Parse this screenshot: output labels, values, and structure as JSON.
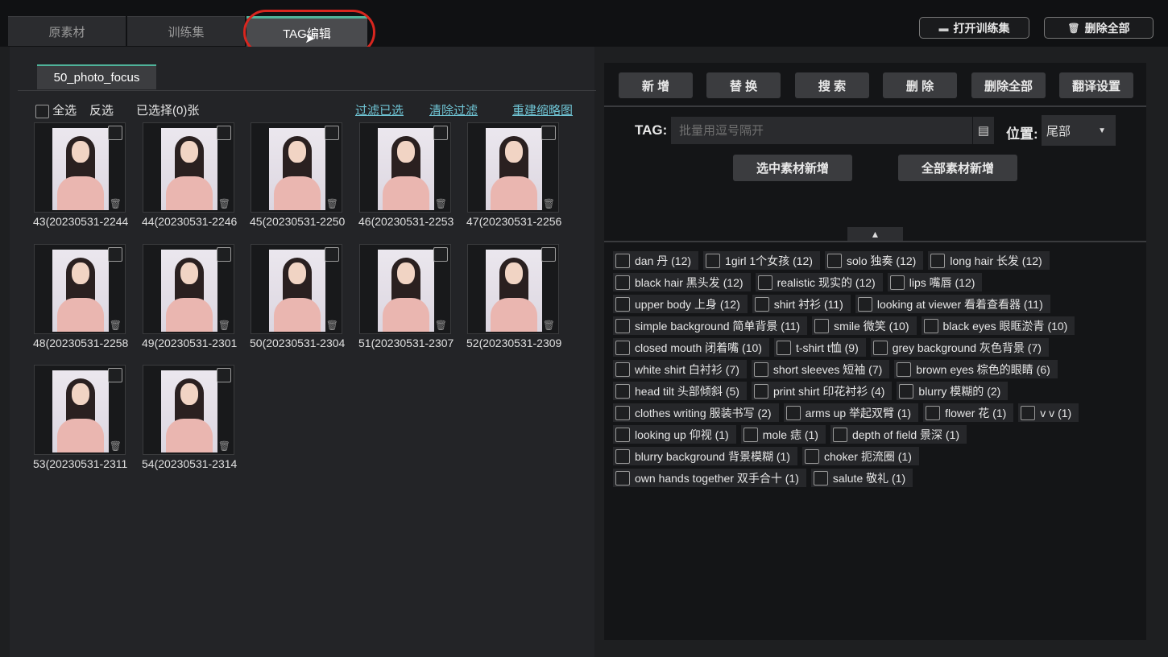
{
  "tabs": [
    {
      "label": "原素材"
    },
    {
      "label": "训练集"
    },
    {
      "label": "TAG编辑"
    }
  ],
  "top_buttons": {
    "open_training": "打开训练集",
    "delete_all": "删除全部"
  },
  "left": {
    "subtab": "50_photo_focus",
    "select_all": "全选",
    "invert": "反选",
    "selected_count": "已选择(0)张",
    "links": [
      "过滤已选",
      "清除过滤",
      "重建缩略图"
    ],
    "images": [
      {
        "name": "43(20230531-2244"
      },
      {
        "name": "44(20230531-2246"
      },
      {
        "name": "45(20230531-2250"
      },
      {
        "name": "46(20230531-2253"
      },
      {
        "name": "47(20230531-2256"
      },
      {
        "name": "48(20230531-2258"
      },
      {
        "name": "49(20230531-2301"
      },
      {
        "name": "50(20230531-2304"
      },
      {
        "name": "51(20230531-2307"
      },
      {
        "name": "52(20230531-2309"
      },
      {
        "name": "53(20230531-2311"
      },
      {
        "name": "54(20230531-2314"
      }
    ]
  },
  "right": {
    "toolbar": [
      "新 增",
      "替 换",
      "搜 索",
      "删 除",
      "删除全部",
      "翻译设置"
    ],
    "tag_label": "TAG:",
    "tag_placeholder": "批量用逗号隔开",
    "pos_label": "位置:",
    "pos_value": "尾部",
    "add_selected": "选中素材新增",
    "add_all": "全部素材新增",
    "tag_rows": [
      [
        "dan 丹 (12)",
        "1girl 1个女孩 (12)",
        "solo 独奏 (12)",
        "long hair 长发 (12)"
      ],
      [
        "black hair 黑头发 (12)",
        "realistic 现实的 (12)",
        "lips 嘴唇 (12)"
      ],
      [
        "upper body 上身 (12)",
        "shirt 衬衫 (11)",
        "looking at viewer 看着查看器 (11)"
      ],
      [
        "simple background 简单背景 (11)",
        "smile 微笑 (10)",
        "black eyes 眼眶淤青 (10)"
      ],
      [
        "closed mouth 闭着嘴 (10)",
        "t-shirt t恤 (9)",
        "grey background 灰色背景 (7)"
      ],
      [
        "white shirt 白衬衫 (7)",
        "short sleeves 短袖 (7)",
        "brown eyes 棕色的眼睛 (6)"
      ],
      [
        "head tilt 头部倾斜 (5)",
        "print shirt 印花衬衫 (4)",
        "blurry 模糊的 (2)"
      ],
      [
        "clothes writing 服装书写 (2)",
        "arms up 举起双臂 (1)",
        "flower 花 (1)",
        "v v (1)"
      ],
      [
        "looking up 仰视 (1)",
        "mole 痣 (1)",
        "depth of field 景深 (1)"
      ],
      [
        "blurry background 背景模糊 (1)",
        "choker 扼流圈 (1)"
      ],
      [
        "own hands together 双手合十 (1)",
        "salute 敬礼 (1)"
      ]
    ]
  },
  "colors": {
    "accent": "#4fb39a",
    "annotation": "#d8261f",
    "link": "#6fc4d4"
  }
}
